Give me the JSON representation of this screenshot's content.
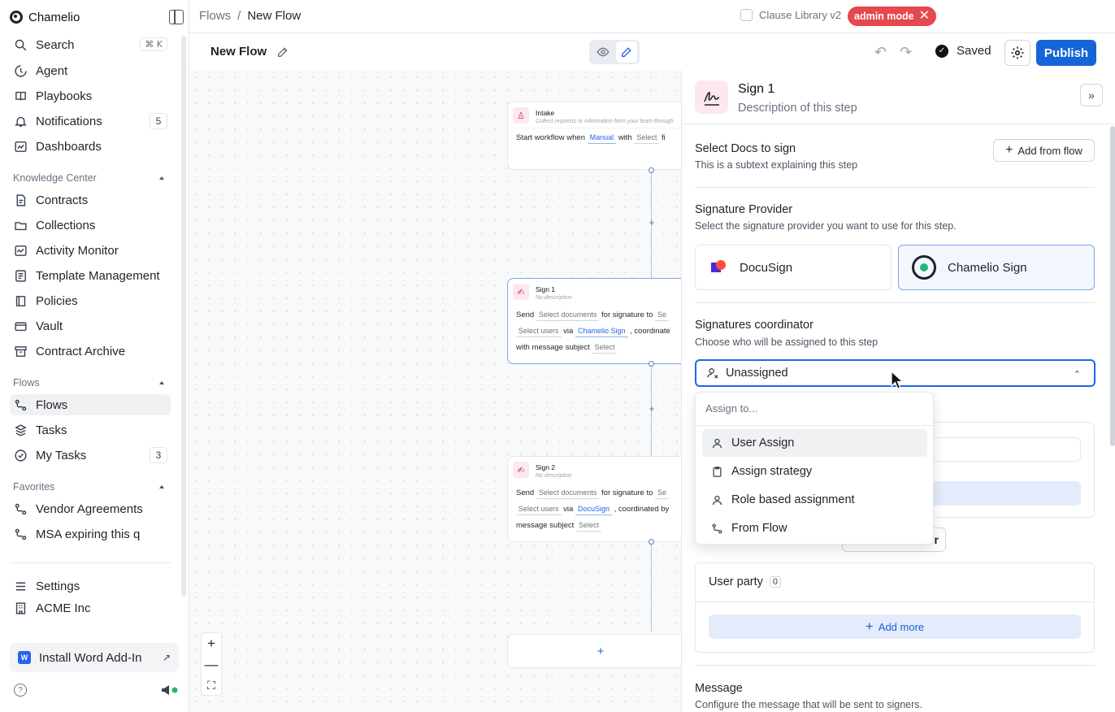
{
  "app": {
    "name": "Chamelio"
  },
  "sidebar": {
    "top_items": [
      {
        "label": "Search",
        "shortcut": "⌘ K",
        "icon": "search-icon"
      },
      {
        "label": "Agent",
        "icon": "agent-icon"
      },
      {
        "label": "Playbooks",
        "icon": "book-icon"
      },
      {
        "label": "Notifications",
        "count": "5",
        "icon": "bell-icon"
      },
      {
        "label": "Dashboards",
        "icon": "dashboard-icon"
      }
    ],
    "knowledge_label": "Knowledge Center",
    "knowledge_items": [
      {
        "label": "Contracts",
        "icon": "contract-icon"
      },
      {
        "label": "Collections",
        "icon": "collection-icon"
      },
      {
        "label": "Activity Monitor",
        "icon": "activity-icon"
      },
      {
        "label": "Template Management",
        "icon": "template-icon"
      },
      {
        "label": "Policies",
        "icon": "policy-icon"
      },
      {
        "label": "Vault",
        "icon": "vault-icon"
      },
      {
        "label": "Contract Archive",
        "icon": "archive-icon"
      }
    ],
    "flows_label": "Flows",
    "flows_items": [
      {
        "label": "Flows",
        "icon": "flow-icon",
        "active": true
      },
      {
        "label": "Tasks",
        "icon": "task-icon"
      },
      {
        "label": "My Tasks",
        "count": "3",
        "icon": "check-circle-icon"
      }
    ],
    "favorites_label": "Favorites",
    "favorites_items": [
      {
        "label": "Vendor Agreements",
        "icon": "flow-icon"
      },
      {
        "label": "MSA expiring this q",
        "icon": "flow-icon"
      }
    ],
    "settings_label": "Settings",
    "org_label": "ACME Inc",
    "install_label": "Install Word Add-In",
    "install_logo": "W",
    "help_glyph": "?"
  },
  "topbar": {
    "breadcrumb_root": "Flows",
    "breadcrumb_sep": "/",
    "breadcrumb_current": "New Flow",
    "clause_label": "Clause Library v2",
    "admin_badge": "admin mode",
    "admin_close": "✕"
  },
  "flowbar": {
    "title": "New Flow",
    "saved_label": "Saved",
    "publish_label": "Publish",
    "undo_glyph": "↶",
    "redo_glyph": "↷",
    "saved_check": "✓"
  },
  "canvas": {
    "intake": {
      "title": "Intake",
      "desc": "Collect requests or information form your team through",
      "text_start": "Start workflow when",
      "chip_manual": "Manual",
      "text_with": "with",
      "chip_select": "Select",
      "text_tail": "fi"
    },
    "sign1": {
      "title": "Sign 1",
      "desc": "No description",
      "text_send": "Send",
      "chip_docs": "Select documents",
      "text_for": "for signature to",
      "chip_trunc": "Se",
      "chip_users": "Select users",
      "text_via": "via",
      "chip_provider": "Chamelio Sign",
      "text_coord": ", coordinate",
      "text_msg": "with message subject",
      "chip_select": "Select"
    },
    "sign2": {
      "title": "Sign 2",
      "desc": "No description",
      "text_send": "Send",
      "chip_docs": "Select documents",
      "text_for": "for signature to",
      "chip_trunc": "Se",
      "chip_users": "Select users",
      "text_via": "via",
      "chip_provider": "DocuSign",
      "text_coord": ", coordinated by",
      "text_msg": "message subject",
      "chip_select": "Select"
    },
    "plus_glyph": "+",
    "zoom_in": "+",
    "zoom_out": "—",
    "fit_glyph": "⛶"
  },
  "panel": {
    "title": "Sign 1",
    "description": "Description of this step",
    "collapse_glyph": "»",
    "docs_heading": "Select Docs to sign",
    "docs_sub": "This is a subtext explaining this step",
    "add_from_flow": "Add from flow",
    "provider_heading": "Signature Provider",
    "provider_sub": "Select the signature provider you want to use for this step.",
    "providers": [
      {
        "name": "DocuSign",
        "selected": false
      },
      {
        "name": "Chamelio Sign",
        "selected": true
      }
    ],
    "coordinator_heading": "Signatures coordinator",
    "coordinator_sub": "Choose who will be assigned to this step",
    "coordinator_value": "Unassigned",
    "chevron_glyph": "⌃",
    "hidden_button_tail": "r",
    "user_party_label": "User party",
    "user_party_count": "0",
    "add_more": "Add more",
    "message_heading": "Message",
    "message_sub": "Configure the message that will be sent to signers."
  },
  "dropdown": {
    "placeholder": "Assign to...",
    "options": [
      {
        "label": "User Assign",
        "icon": "user-icon",
        "highlighted": true
      },
      {
        "label": "Assign strategy",
        "icon": "clipboard-icon"
      },
      {
        "label": "Role based assignment",
        "icon": "user-icon"
      },
      {
        "label": "From Flow",
        "icon": "flow-icon"
      }
    ]
  },
  "colors": {
    "accent": "#1565d8",
    "admin_badge": "#e5484d",
    "sign_node_icon_bg": "#fde8ef",
    "add_more_bg": "#e4ebfb",
    "chamelio_green": "#1fb877"
  }
}
